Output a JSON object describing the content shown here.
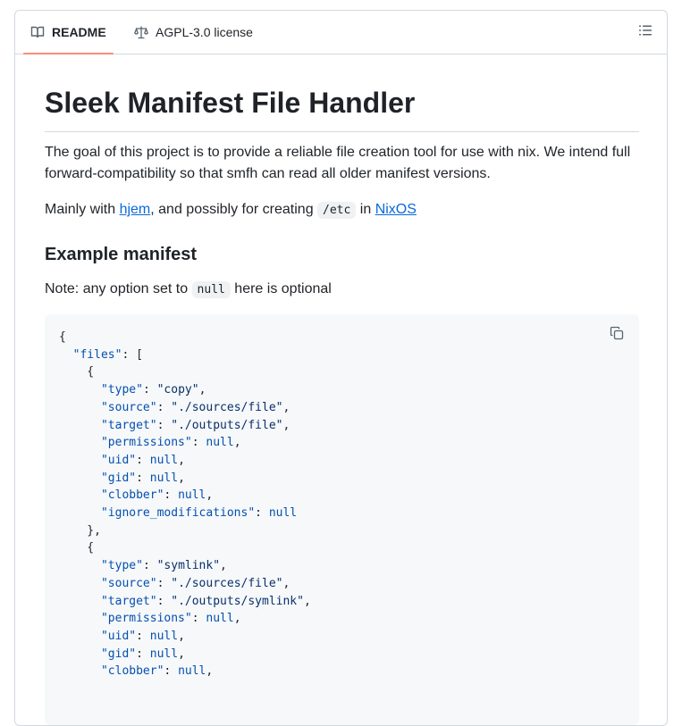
{
  "tabs": {
    "readme": "README",
    "license": "AGPL-3.0 license"
  },
  "article": {
    "title": "Sleek Manifest File Handler",
    "intro": "The goal of this project is to provide a reliable file creation tool for use with nix. We intend full forward-compatibility so that smfh can read all older manifest versions.",
    "usage_prefix": "Mainly with ",
    "usage_link1": "hjem",
    "usage_middle": ", and possibly for creating ",
    "usage_code": "/etc",
    "usage_in": " in ",
    "usage_link2": "NixOS",
    "example_heading": "Example manifest",
    "note_prefix": "Note: any option set to ",
    "note_code": "null",
    "note_suffix": " here is optional"
  },
  "code": {
    "lines": [
      "{",
      "  \"files\": [",
      "    {",
      "      \"type\": \"copy\",",
      "      \"source\": \"./sources/file\",",
      "      \"target\": \"./outputs/file\",",
      "      \"permissions\": null,",
      "      \"uid\": null,",
      "      \"gid\": null,",
      "      \"clobber\": null,",
      "      \"ignore_modifications\": null",
      "    },",
      "    {",
      "      \"type\": \"symlink\",",
      "      \"source\": \"./sources/file\",",
      "      \"target\": \"./outputs/symlink\",",
      "      \"permissions\": null,",
      "      \"uid\": null,",
      "      \"gid\": null,",
      "      \"clobber\": null,"
    ]
  },
  "icons": {
    "readme": "book-icon",
    "license": "law-icon",
    "toc": "list-unordered-icon",
    "copy": "copy-icon"
  },
  "colors": {
    "link": "#0969da",
    "tab_underline": "#fd8c73",
    "code_bg": "#f6f8fa",
    "json_key": "#0550ae",
    "json_string": "#0a3069"
  }
}
